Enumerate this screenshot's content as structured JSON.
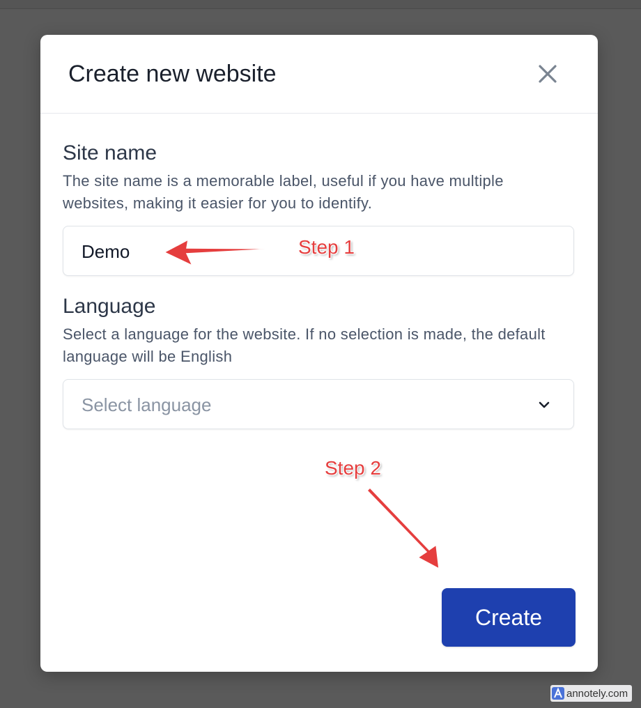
{
  "modal": {
    "title": "Create new website",
    "close_icon": "close-icon"
  },
  "site_name": {
    "label": "Site name",
    "help": "The site name is a memorable label, useful if you have multiple websites, making it easier for you to identify.",
    "value": "Demo"
  },
  "language": {
    "label": "Language",
    "help": "Select a language for the website. If no selection is made, the default language will be English",
    "placeholder": "Select language",
    "chevron_icon": "chevron-down-icon"
  },
  "create_button": {
    "label": "Create",
    "color": "#1e40af"
  },
  "annotations": {
    "step1": "Step 1",
    "step2": "Step 2",
    "color": "#e53e3e"
  },
  "watermark": {
    "text": "annotely.com"
  }
}
